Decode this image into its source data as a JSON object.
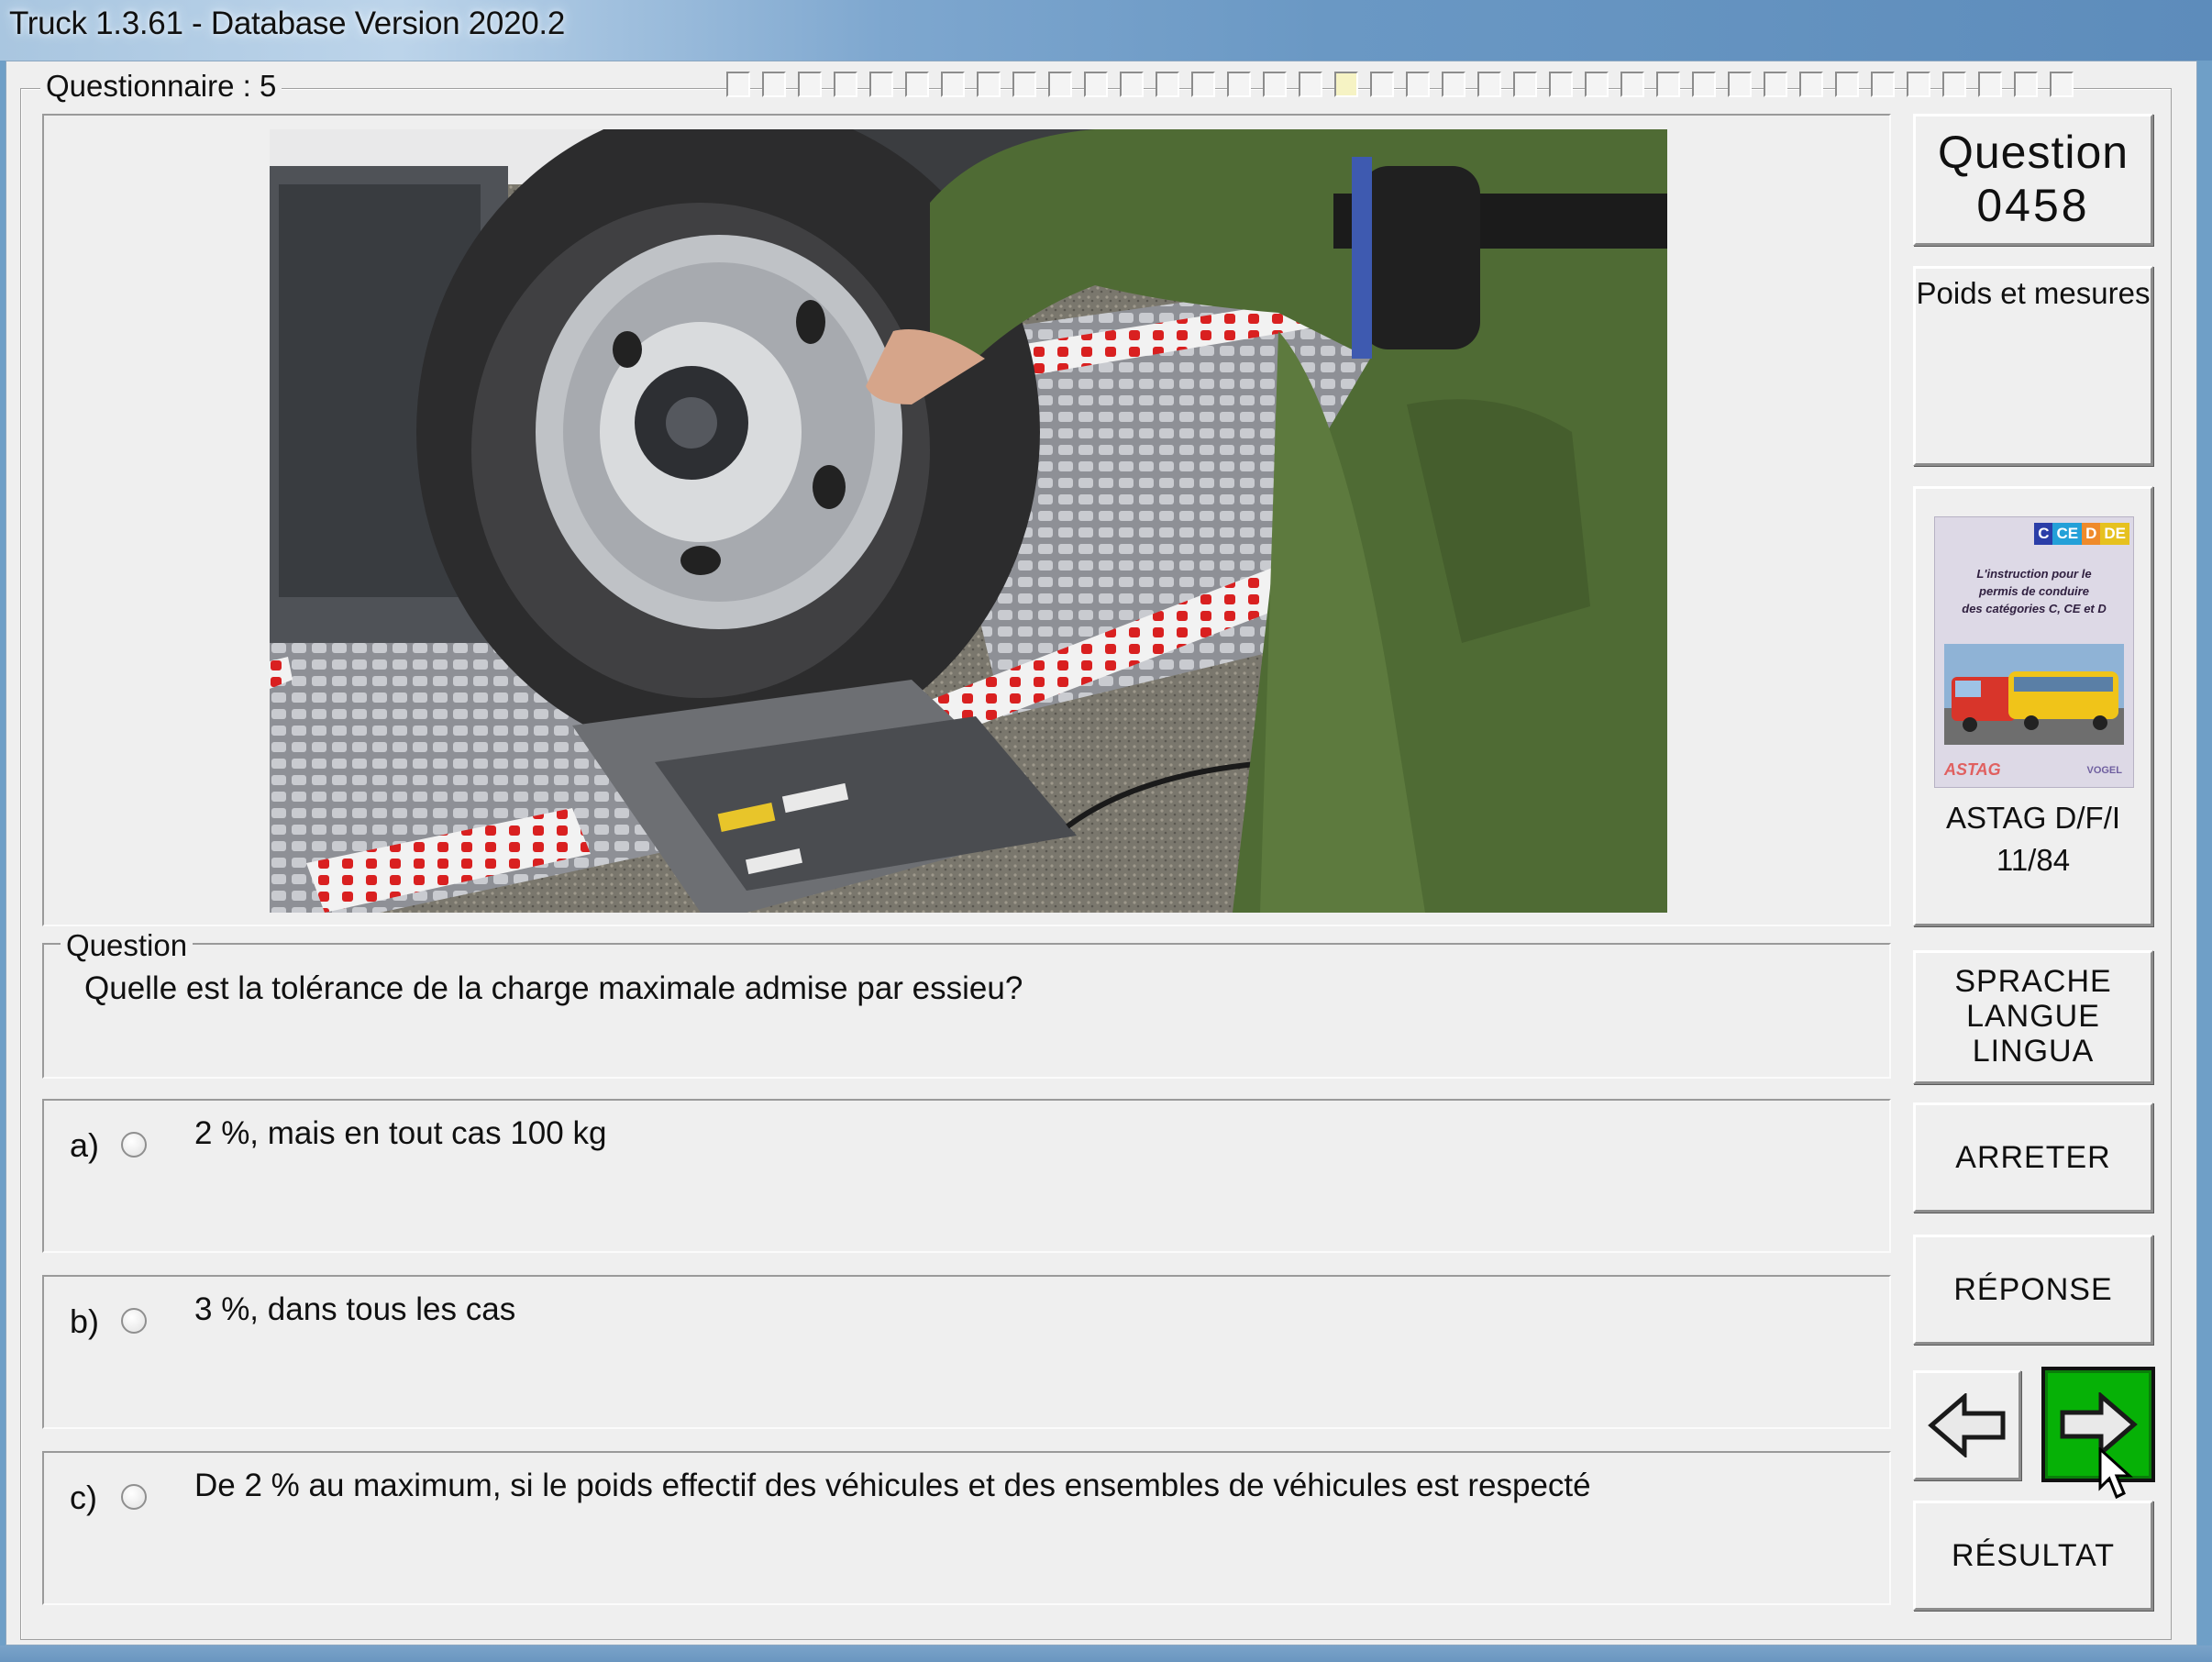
{
  "window": {
    "title": "Truck 1.3.61 - Database Version 2020.2"
  },
  "questionnaire": {
    "label": "Questionnaire : 5",
    "progress": {
      "total": 38,
      "current": 18
    }
  },
  "question_number": {
    "line1": "Question",
    "line2": "0458"
  },
  "category": "Poids et mesures",
  "source": {
    "cover_tags": [
      "C",
      "CE",
      "D",
      "DE"
    ],
    "cover_tag_colors": [
      "#2b3ea8",
      "#23a0d8",
      "#ef8a2a",
      "#e6c11f"
    ],
    "cover_text": [
      "L'instruction pour le",
      "permis de conduire",
      "des catégories C, CE et D"
    ],
    "cover_logo_left": "ASTAG",
    "cover_logo_right": "VOGEL",
    "label": "ASTAG D/F/I",
    "pages": "11/84"
  },
  "question": {
    "legend": "Question",
    "text": "Quelle est la tolérance de la charge maximale admise par essieu?"
  },
  "answers": [
    {
      "label": "a)",
      "text": "2 %, mais en tout cas 100 kg",
      "selected": false
    },
    {
      "label": "b)",
      "text": "3 %, dans tous les cas",
      "selected": false
    },
    {
      "label": "c)",
      "text": "De 2 % au maximum, si le poids effectif des véhicules et des ensembles de véhicules est respecté",
      "selected": false
    }
  ],
  "buttons": {
    "language": [
      "SPRACHE",
      "LANGUE",
      "LINGUA"
    ],
    "stop": "ARRETER",
    "answer": "RÉPONSE",
    "previous_icon": "arrow-left-icon",
    "next_icon": "arrow-right-icon",
    "result": "RÉSULTAT"
  },
  "colors": {
    "next_button": "#06b106",
    "title_bar": "#6a98c4"
  }
}
